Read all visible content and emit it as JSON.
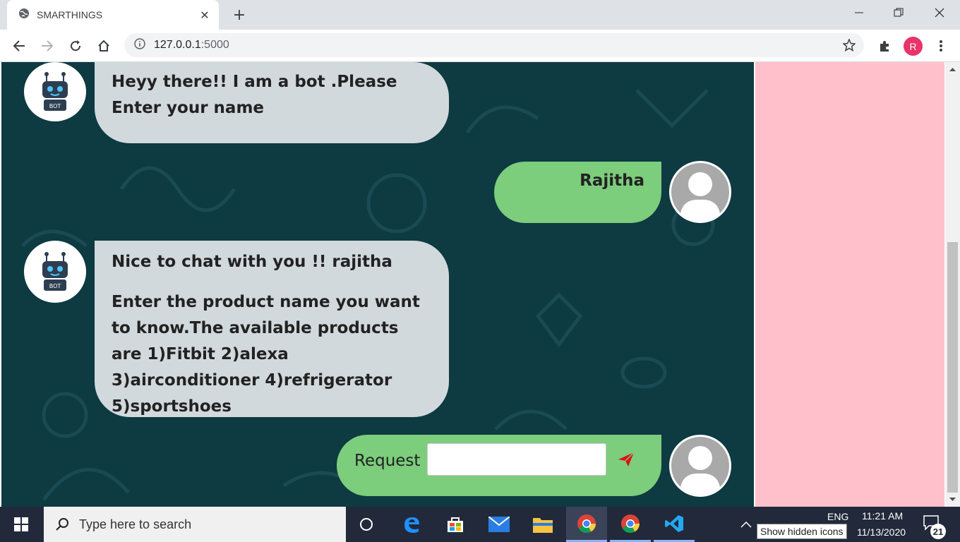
{
  "browser": {
    "tab_title": "SMARTHINGS",
    "url_host": "127.0.0.1",
    "url_port": ":5000",
    "profile_initial": "R"
  },
  "chat": {
    "messages": [
      {
        "from": "bot",
        "lines": [
          "Heyy there!! I am a bot .Please Enter your name"
        ]
      },
      {
        "from": "user",
        "text": "Rajitha"
      },
      {
        "from": "bot",
        "lines": [
          "Nice to chat with you !! rajitha",
          "Enter the product name you want to know.The available products are 1)Fitbit 2)alexa 3)airconditioner 4)refrigerator 5)sportshoes"
        ]
      }
    ],
    "request_label": "Request",
    "request_value": ""
  },
  "taskbar": {
    "search_placeholder": "Type here to search",
    "language": "ENG",
    "time": "11:21 AM",
    "date": "11/13/2020",
    "notification_count": "21",
    "tooltip": "Show hidden icons"
  },
  "colors": {
    "chat_bg": "#0e3a42",
    "bot_bubble": "#d2d9dd",
    "user_bubble": "#7ccd7c",
    "side_panel": "#ffc0cb",
    "send_icon": "#e01010"
  }
}
